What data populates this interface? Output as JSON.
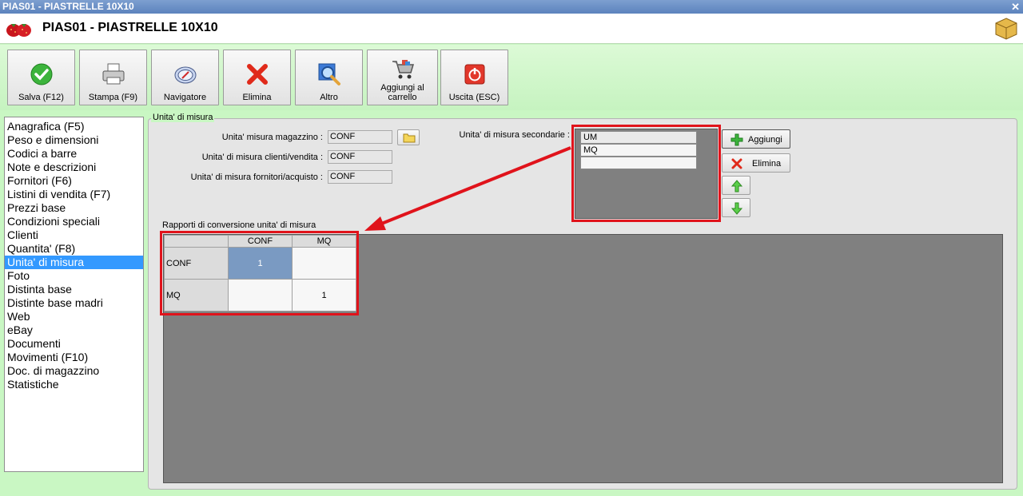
{
  "window": {
    "title": "PIAS01 - PIASTRELLE 10X10",
    "close_glyph": "✕"
  },
  "header": {
    "title": "PIAS01 - PIASTRELLE 10X10"
  },
  "toolbar": {
    "buttons": [
      {
        "label": "Salva (F12)",
        "icon": "check-icon"
      },
      {
        "label": "Stampa (F9)",
        "icon": "printer-icon"
      },
      {
        "label": "Navigatore",
        "icon": "compass-icon"
      },
      {
        "label": "Elimina",
        "icon": "delete-x-icon"
      },
      {
        "label": "Altro",
        "icon": "magnifier-icon"
      },
      {
        "label": "Aggiungi al carrello",
        "icon": "cart-icon"
      },
      {
        "label": "Uscita (ESC)",
        "icon": "power-icon"
      }
    ]
  },
  "nav": {
    "items": [
      "Anagrafica (F5)",
      "Peso e dimensioni",
      "Codici a barre",
      "Note e descrizioni",
      "Fornitori (F6)",
      "Listini di vendita (F7)",
      "Prezzi base",
      "Condizioni speciali",
      "Clienti",
      "Quantita' (F8)",
      "Unita' di misura",
      "Foto",
      "Distinta base",
      "Distinte base madri",
      "Web",
      "eBay",
      "Documenti",
      "Movimenti (F10)",
      "Doc. di magazzino",
      "Statistiche"
    ],
    "selected": "Unita' di misura"
  },
  "panel": {
    "legend": "Unita' di misura",
    "fields": [
      {
        "label": "Unita' misura magazzino :",
        "value": "CONF"
      },
      {
        "label": "Unita' di misura clienti/vendita :",
        "value": "CONF"
      },
      {
        "label": "Unita' di misura fornitori/acquisto :",
        "value": "CONF"
      }
    ],
    "secondary": {
      "label": "Unita' di misura secondarie :",
      "rows": [
        "UM",
        "MQ",
        ""
      ]
    },
    "buttons": {
      "add": "Aggiungi",
      "delete": "Elimina"
    },
    "conversion": {
      "label": "Rapporti di conversione unita' di misura",
      "columns": [
        "CONF",
        "MQ"
      ],
      "rows": [
        {
          "name": "CONF",
          "values": [
            "1",
            ""
          ]
        },
        {
          "name": "MQ",
          "values": [
            "",
            "1"
          ]
        }
      ]
    }
  },
  "colors": {
    "accent_red": "#e0131b",
    "selection_blue": "#3399ff",
    "background_green": "#c9f7c3"
  }
}
